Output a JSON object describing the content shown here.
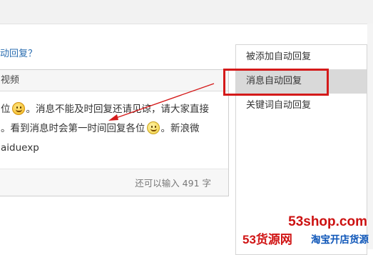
{
  "header": {
    "question_link": "动回复？"
  },
  "editor": {
    "tab_label": "视频",
    "content_lines": [
      {
        "before": "位",
        "emoji": "grin-emoji",
        "after": "。消息不能及时回复还请见谅，请大家直接"
      },
      {
        "before": "。看到消息时会第一时间回复各位",
        "emoji": "smile-emoji",
        "after": "。新浪微"
      },
      {
        "before": "aiduexp",
        "emoji": "",
        "after": ""
      }
    ],
    "counter": "还可以输入 491 字"
  },
  "sidebar": {
    "items": [
      {
        "label": "被添加自动回复",
        "active": false
      },
      {
        "label": "消息自动回复",
        "active": true
      },
      {
        "label": "关键词自动回复",
        "active": false
      }
    ]
  },
  "annotation": {
    "highlight_color": "#d41a1a",
    "arrow_color": "#d41a1a"
  },
  "watermark": {
    "url": "53shop.com",
    "brand": "53货源网",
    "slogan": "淘宝开店货源"
  }
}
